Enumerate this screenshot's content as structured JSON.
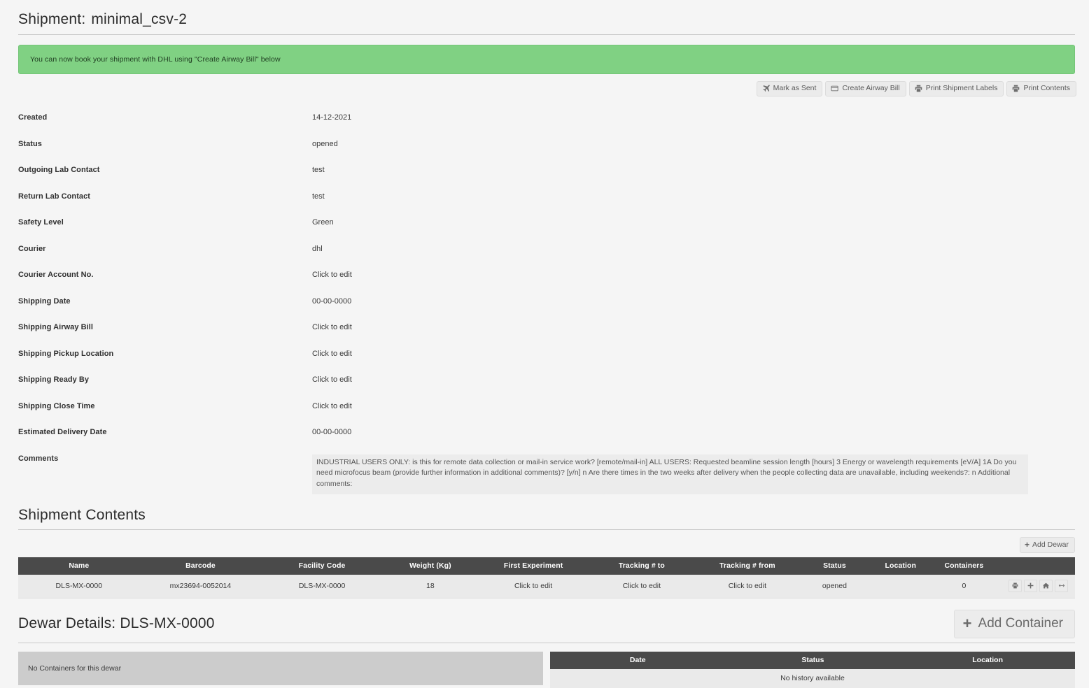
{
  "header": {
    "title_label": "Shipment:",
    "shipment_name": "minimal_csv-2"
  },
  "alert": {
    "message": "You can now book your shipment with DHL using \"Create Airway Bill\" below",
    "background_color": "#80d183"
  },
  "toolbar": {
    "buttons": [
      {
        "label": "Mark as Sent",
        "icon": "plane-icon"
      },
      {
        "label": "Create Airway Bill",
        "icon": "card-icon"
      },
      {
        "label": "Print Shipment Labels",
        "icon": "printer-icon"
      },
      {
        "label": "Print Contents",
        "icon": "printer-icon"
      }
    ]
  },
  "details": {
    "rows": [
      {
        "label": "Created",
        "value": "14-12-2021",
        "editable": false
      },
      {
        "label": "Status",
        "value": "opened",
        "editable": false
      },
      {
        "label": "Outgoing Lab Contact",
        "value": "test",
        "editable": false
      },
      {
        "label": "Return Lab Contact",
        "value": "test",
        "editable": false
      },
      {
        "label": "Safety Level",
        "value": "Green",
        "editable": false
      },
      {
        "label": "Courier",
        "value": "dhl",
        "editable": false
      },
      {
        "label": "Courier Account No.",
        "value": "Click to edit",
        "editable": true
      },
      {
        "label": "Shipping Date",
        "value": "00-00-0000",
        "editable": true
      },
      {
        "label": "Shipping Airway Bill",
        "value": "Click to edit",
        "editable": true
      },
      {
        "label": "Shipping Pickup Location",
        "value": "Click to edit",
        "editable": true
      },
      {
        "label": "Shipping Ready By",
        "value": "Click to edit",
        "editable": true
      },
      {
        "label": "Shipping Close Time",
        "value": "Click to edit",
        "editable": true
      },
      {
        "label": "Estimated Delivery Date",
        "value": "00-00-0000",
        "editable": true
      }
    ],
    "comments_label": "Comments",
    "comments_value": "INDUSTRIAL USERS ONLY: is this for remote data collection or mail-in service work? [remote/mail-in] ALL USERS: Requested beamline session length [hours] 3 Energy or wavelength requirements [eV/A] 1A Do you need microfocus beam (provide further information in additional comments)? [y/n] n Are there times in the two weeks after delivery when the people collecting data are unavailable, including weekends?: n Additional comments:"
  },
  "shipment_contents": {
    "title": "Shipment Contents",
    "add_dewar_label": "Add Dewar",
    "columns": [
      "Name",
      "Barcode",
      "Facility Code",
      "Weight (Kg)",
      "First Experiment",
      "Tracking # to",
      "Tracking # from",
      "Status",
      "Location",
      "Containers",
      ""
    ],
    "rows": [
      {
        "name": "DLS-MX-0000",
        "barcode": "mx23694-0052014",
        "facility_code": "DLS-MX-0000",
        "weight": "18",
        "first_experiment": "Click to edit",
        "tracking_to": "Click to edit",
        "tracking_from": "Click to edit",
        "status": "opened",
        "location": "",
        "containers": "0",
        "actions": [
          "printer-icon",
          "plus-icon",
          "home-icon",
          "arrows-horizontal-icon"
        ]
      }
    ]
  },
  "dewar_details": {
    "title_label": "Dewar Details:",
    "dewar_name": "DLS-MX-0000",
    "add_container_label": "Add Container",
    "no_containers_message": "No Containers for this dewar",
    "history": {
      "columns": [
        "Date",
        "Status",
        "Location"
      ],
      "empty_message": "No history available"
    }
  },
  "colors": {
    "alert_green": "#80d183",
    "table_header_dark": "#4a4a4a",
    "row_background": "#eaeaea",
    "panel_gray": "#cccccc",
    "page_background": "#f5f5f5"
  }
}
